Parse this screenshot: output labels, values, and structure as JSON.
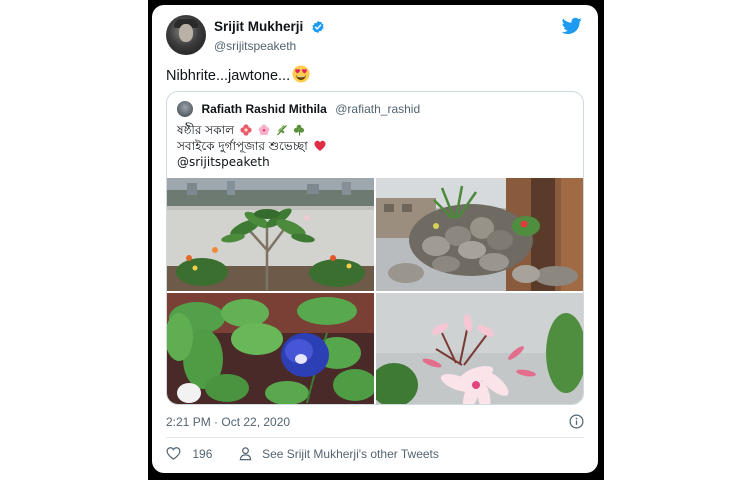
{
  "author": {
    "display_name": "Srijit Mukherji",
    "handle": "@srijitspeaketh",
    "verified": true
  },
  "tweet": {
    "text": "Nibhrite...jawtone...",
    "emoji": "heart-eyes-emoji",
    "timestamp": "2:21 PM · Oct 22, 2020",
    "likes": "196",
    "other_tweets_label": "See Srijit Mukherji's other Tweets"
  },
  "quoted_tweet": {
    "display_name": "Rafiath Rashid Mithila",
    "handle": "@rafiath_rashid",
    "line1": "ষষ্ঠীর সকাল",
    "line2": "সবাইকে দুর্গাপূজার শুভেচ্ছা",
    "mention": "@srijitspeaketh",
    "photos": [
      "plumeria-balcony-photo",
      "rock-garden-photo",
      "butterfly-pea-flower-photo",
      "pink-flower-cluster-photo"
    ]
  },
  "colors": {
    "twitter_blue": "#1d9bf0",
    "text_primary": "#0f1419",
    "text_secondary": "#536471",
    "border": "#cfd9de",
    "heart_red": "#e0245e"
  }
}
